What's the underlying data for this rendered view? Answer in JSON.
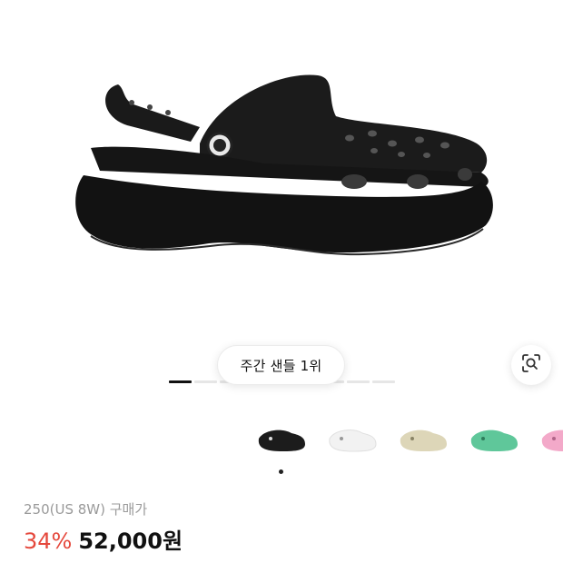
{
  "product": {
    "image_alt": "black platform clog",
    "rank_badge": "주간 샌들 1위",
    "size_label": "250(US 8W) 구매가",
    "discount": "34%",
    "price": "52,000원"
  },
  "gallery": {
    "pages": 9,
    "active_page": 1
  },
  "colors": [
    {
      "name": "black",
      "hex": "#1c1c1c"
    },
    {
      "name": "white",
      "hex": "#f2f2f2"
    },
    {
      "name": "beige",
      "hex": "#ddd6b8"
    },
    {
      "name": "mint",
      "hex": "#5fc79a"
    },
    {
      "name": "pink",
      "hex": "#f3a9c9"
    }
  ],
  "selected_color": "black",
  "icons": {
    "lens": "lens-search-icon"
  },
  "accent": {
    "discount_color": "#e5483c"
  }
}
